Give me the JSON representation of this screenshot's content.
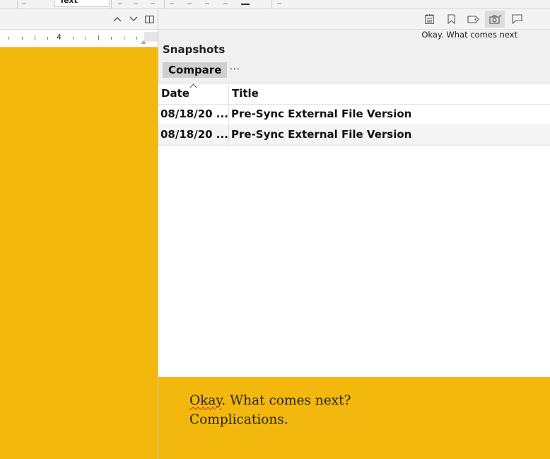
{
  "toolbar": {
    "font_value": "Text"
  },
  "ruler": {
    "label": "4"
  },
  "inspector": {
    "document_title": "Okay. What comes next",
    "section_label": "Snapshots",
    "compare_label": "Compare",
    "more_label": "⋯",
    "icons": [
      "notes-icon",
      "bookmark-icon",
      "tag-icon",
      "snapshot-icon",
      "comment-icon"
    ]
  },
  "table": {
    "headers": {
      "date": "Date",
      "title": "Title"
    },
    "rows": [
      {
        "date": "08/18/20 ...",
        "title": "Pre-Sync External File Version"
      },
      {
        "date": "08/18/20 ...",
        "title": "Pre-Sync External File Version"
      }
    ]
  },
  "notes": {
    "word1": "Okay",
    "rest_line1": ". What comes next?",
    "line2": "Complications."
  },
  "colors": {
    "document_background": "#f2b80d",
    "panel_background": "#f0f0f0"
  }
}
